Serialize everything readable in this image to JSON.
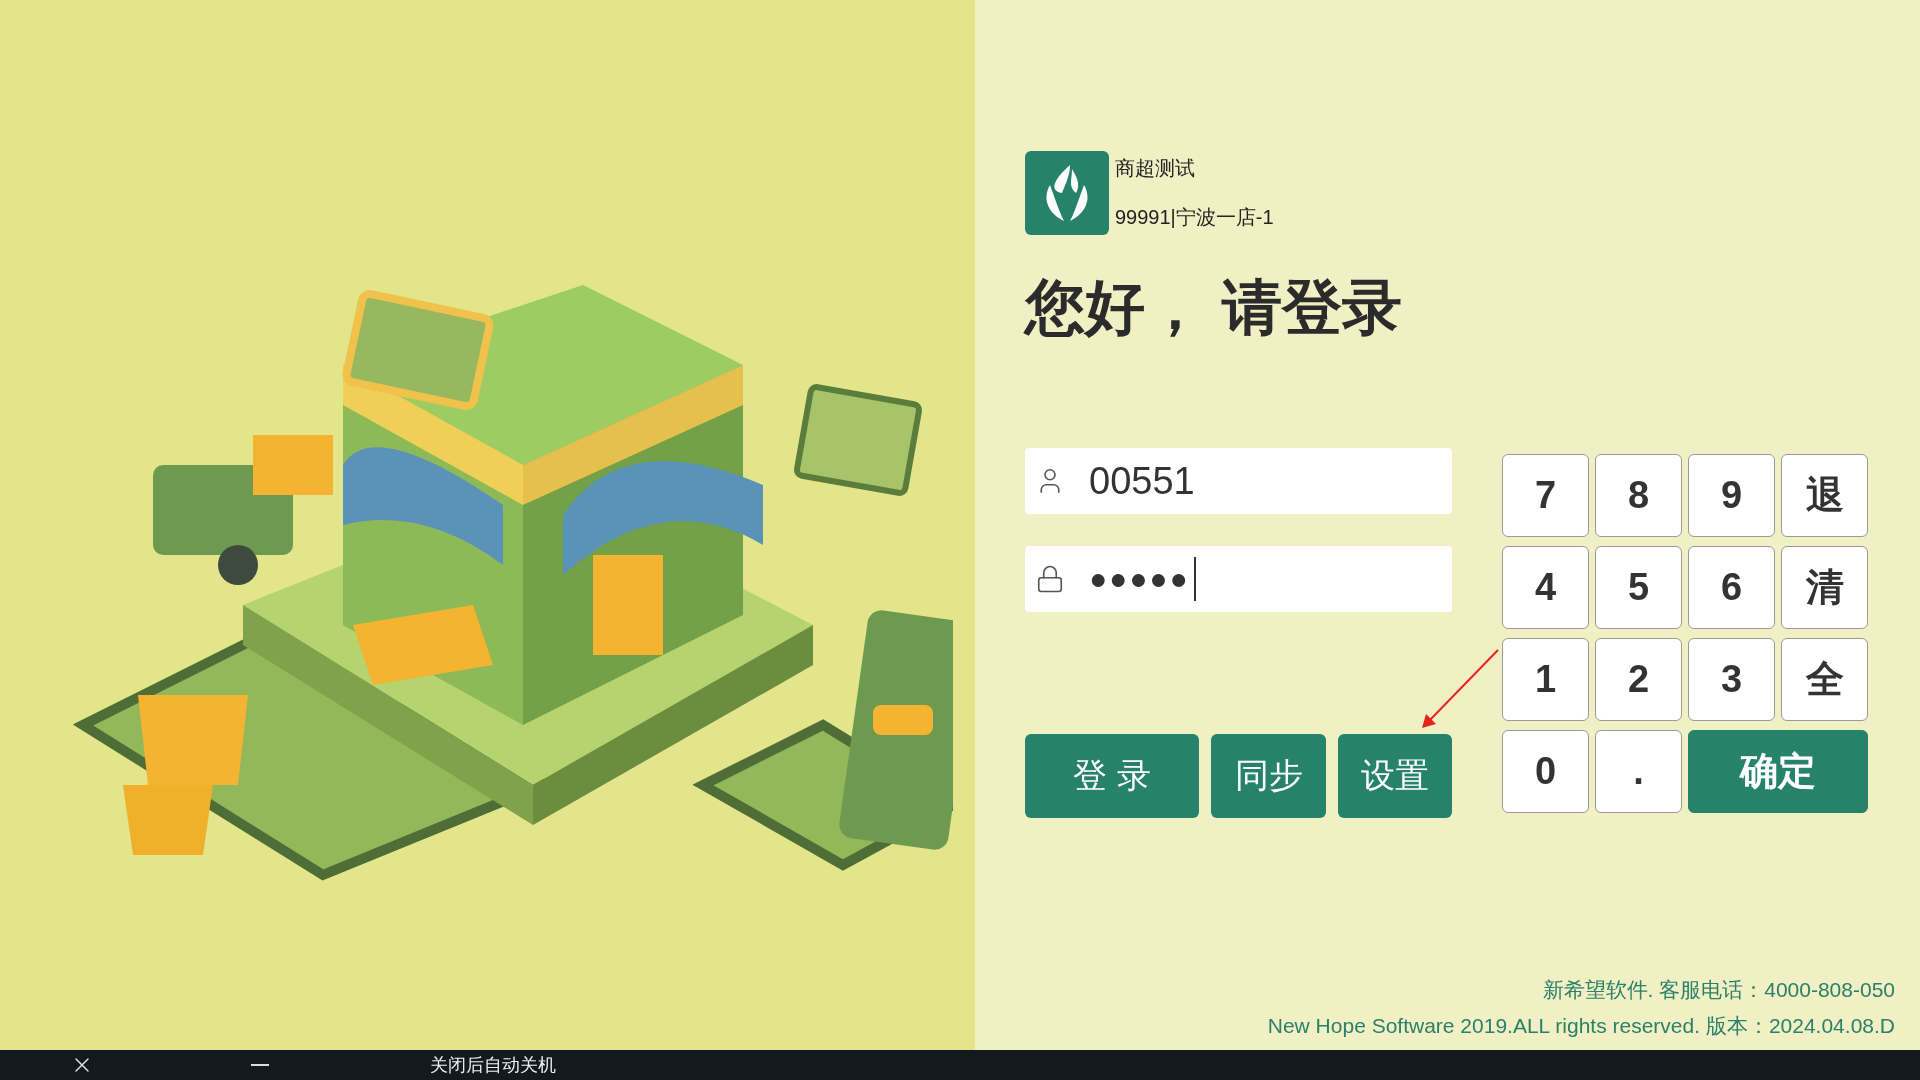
{
  "store": {
    "name": "商超测试",
    "branch": "99991|宁波一店-1"
  },
  "greeting": "您好， 请登录",
  "username": {
    "value": "00551"
  },
  "password": {
    "value": "●●●●●"
  },
  "actions": [
    "登 录",
    "同步",
    "设置"
  ],
  "keypad": [
    {
      "label": "7",
      "kind": "key"
    },
    {
      "label": "8",
      "kind": "key"
    },
    {
      "label": "9",
      "kind": "key"
    },
    {
      "label": "退",
      "kind": "key"
    },
    {
      "label": "4",
      "kind": "key"
    },
    {
      "label": "5",
      "kind": "key"
    },
    {
      "label": "6",
      "kind": "key"
    },
    {
      "label": "清",
      "kind": "key"
    },
    {
      "label": "1",
      "kind": "key"
    },
    {
      "label": "2",
      "kind": "key"
    },
    {
      "label": "3",
      "kind": "key"
    },
    {
      "label": "全",
      "kind": "key"
    },
    {
      "label": "0",
      "kind": "key"
    },
    {
      "label": ".",
      "kind": "key"
    },
    {
      "label": "确定",
      "kind": "confirm"
    }
  ],
  "footer": [
    "新希望软件. 客服电话：4000-808-050",
    "New Hope Software 2019.ALL rights reserved. 版本：2024.04.08.D"
  ],
  "taskbar": {
    "status": "关闭后自动关机"
  }
}
